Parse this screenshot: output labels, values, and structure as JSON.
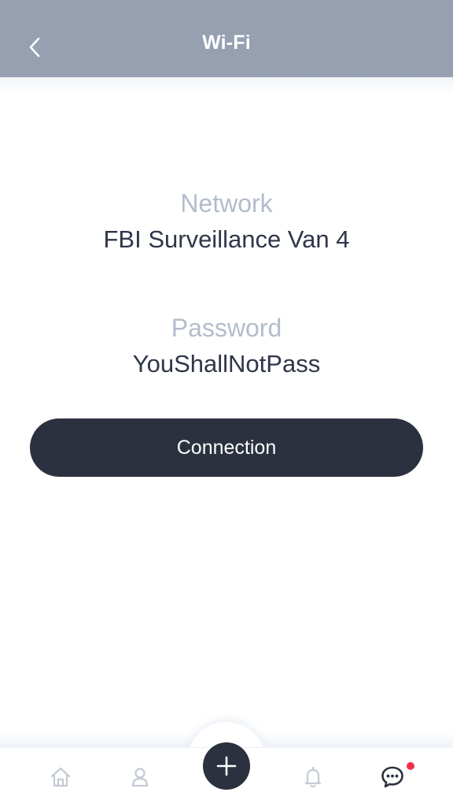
{
  "header": {
    "title": "Wi-Fi",
    "back_icon": "chevron-left-icon"
  },
  "network": {
    "label": "Network",
    "value": "FBI Surveillance Van 4"
  },
  "password": {
    "label": "Password",
    "value": "YouShallNotPass"
  },
  "connect_button": {
    "label": "Connection"
  },
  "tabbar": {
    "items": [
      {
        "icon": "home-icon"
      },
      {
        "icon": "user-icon"
      },
      {
        "icon": "plus-icon"
      },
      {
        "icon": "bell-icon"
      },
      {
        "icon": "chat-bubble-icon",
        "has_unread": true
      }
    ]
  },
  "colors": {
    "header_bg": "#96a0b1",
    "label": "#b2bccb",
    "value_text": "#2f3649",
    "button_bg": "#2c313f",
    "tab_icon_inactive": "#c4cbd6",
    "tab_icon_active": "#2c313f",
    "unread_dot": "#f2304c"
  }
}
